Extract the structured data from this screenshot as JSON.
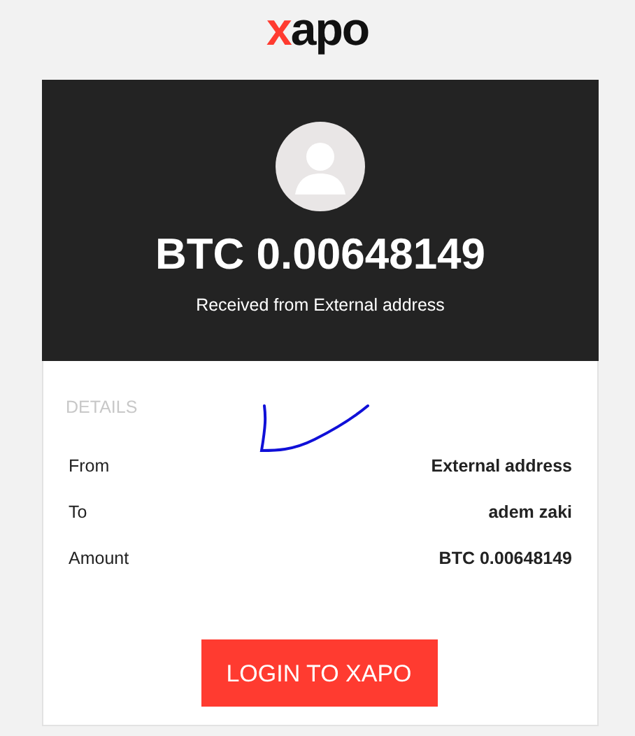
{
  "logo": [
    {
      "text": "x",
      "color": "#ff3b30"
    },
    {
      "text": "apo",
      "color": "#111111"
    }
  ],
  "header": {
    "amount": "BTC 0.00648149",
    "subtitle": "Received from External address"
  },
  "details": {
    "heading": "DETAILS",
    "rows": [
      {
        "label": "From",
        "value": "External address"
      },
      {
        "label": "To",
        "value": "adem zaki"
      },
      {
        "label": "Amount",
        "value": "BTC 0.00648149"
      }
    ]
  },
  "button": "LOGIN TO XAPO"
}
